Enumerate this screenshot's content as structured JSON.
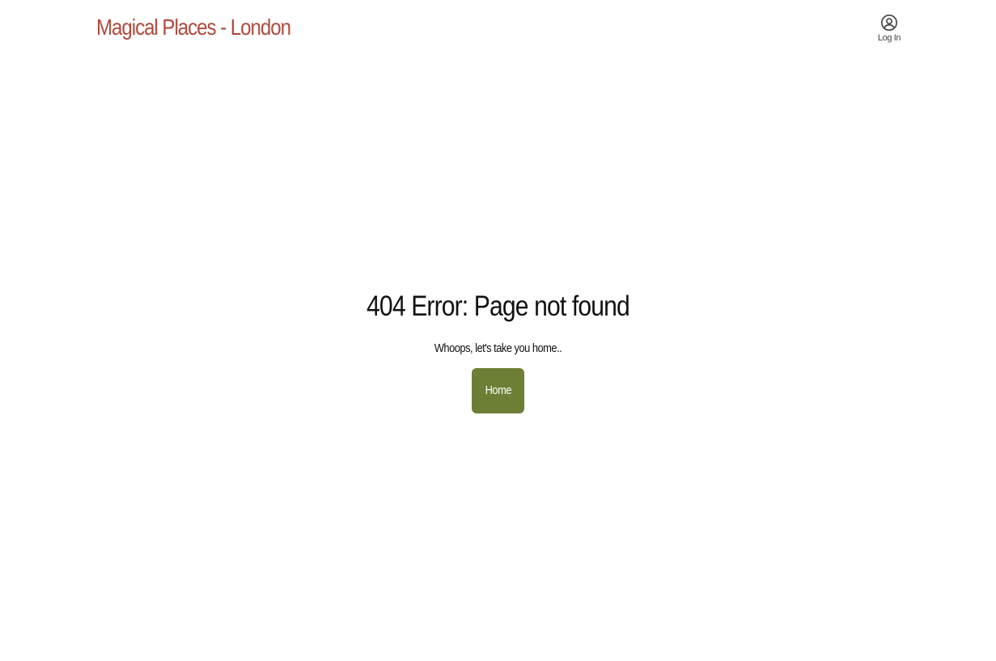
{
  "header": {
    "brand": "Magical Places - London",
    "login_label": "Log In",
    "login_icon": "user-circle-icon"
  },
  "main": {
    "title": "404 Error: Page not found",
    "subtitle": "Whoops, let's take you home..",
    "home_button_label": "Home"
  },
  "colors": {
    "brand": "#b04a3c",
    "button_bg": "#6d7f35",
    "button_text": "#ffffff",
    "icon": "#444444",
    "text": "#111111",
    "background": "#ffffff"
  }
}
